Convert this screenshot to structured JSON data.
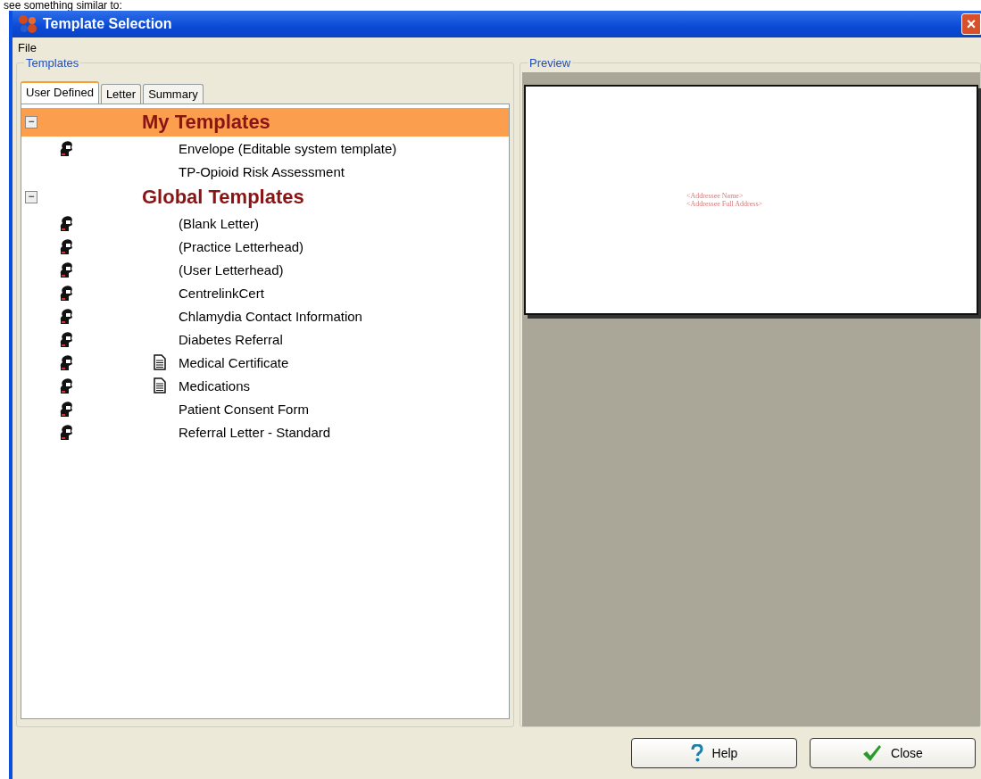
{
  "caption": "see something similar to:",
  "window": {
    "title": "Template Selection",
    "close": "×"
  },
  "menu": [
    {
      "label": "File"
    }
  ],
  "templates": {
    "title": "Templates",
    "tabs": [
      {
        "label": "User Defined",
        "selected": true
      },
      {
        "label": "Letter",
        "selected": false
      },
      {
        "label": "Summary",
        "selected": false
      }
    ],
    "tree": [
      {
        "label": "My Templates",
        "expanded": true,
        "selected": true,
        "toggle": "−",
        "children": [
          {
            "label": "Envelope (Editable system template)",
            "person": true,
            "document": false
          },
          {
            "label": "TP-Opioid Risk Assessment",
            "person": false,
            "document": false
          }
        ]
      },
      {
        "label": "Global Templates",
        "expanded": true,
        "selected": false,
        "toggle": "−",
        "children": [
          {
            "label": "(Blank Letter)",
            "person": true,
            "document": false
          },
          {
            "label": "(Practice Letterhead)",
            "person": true,
            "document": false
          },
          {
            "label": "(User Letterhead)",
            "person": true,
            "document": false
          },
          {
            "label": "CentrelinkCert",
            "person": true,
            "document": false
          },
          {
            "label": "Chlamydia Contact Information",
            "person": true,
            "document": false
          },
          {
            "label": "Diabetes Referral",
            "person": true,
            "document": false
          },
          {
            "label": "Medical Certificate",
            "person": true,
            "document": true
          },
          {
            "label": "Medications",
            "person": true,
            "document": true
          },
          {
            "label": "Patient Consent Form",
            "person": true,
            "document": false
          },
          {
            "label": "Referral Letter - Standard",
            "person": true,
            "document": false
          }
        ]
      }
    ]
  },
  "preview": {
    "title": "Preview",
    "lines": [
      "<Addressee Name>",
      "<Addressee Full Address>"
    ]
  },
  "buttons": [
    {
      "kind": "help",
      "label": "Help"
    },
    {
      "kind": "close",
      "label": "Close"
    }
  ]
}
